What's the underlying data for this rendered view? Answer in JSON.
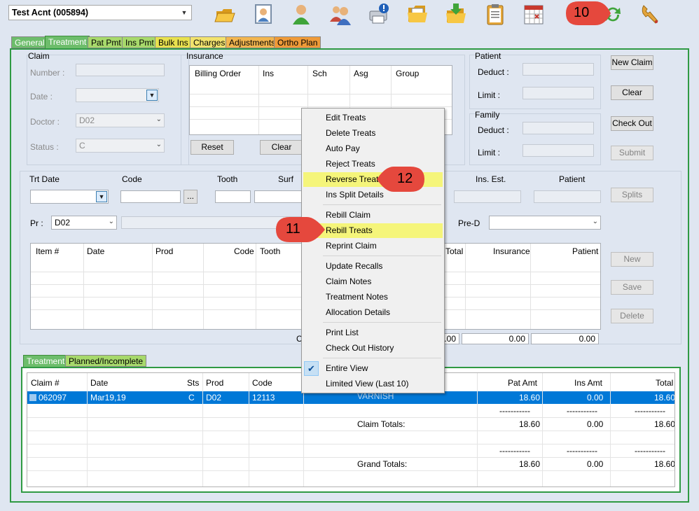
{
  "account": {
    "name": "Test Acnt (005894)"
  },
  "toolbar": {
    "icons": [
      "folder-open-icon",
      "patient-portrait-icon",
      "person-icon",
      "family-icon",
      "printer-alert-icon",
      "files-icon",
      "download-folder-icon",
      "clipboard-icon",
      "calendar-icon",
      "refresh-icon",
      "wrench-icon"
    ]
  },
  "tabs": [
    {
      "label": "General",
      "color": "#6dbd6b"
    },
    {
      "label": "Treatment",
      "color": "#6dbd6b"
    },
    {
      "label": "Pat Pmt",
      "color": "#a7d96b"
    },
    {
      "label": "Ins Pmt",
      "color": "#a7d96b"
    },
    {
      "label": "Bulk Ins",
      "color": "#e8e14e"
    },
    {
      "label": "Charges",
      "color": "#f2e36d"
    },
    {
      "label": "Adjustments",
      "color": "#f2b54f"
    },
    {
      "label": "Ortho Plan",
      "color": "#ef9a38"
    }
  ],
  "claim": {
    "title": "Claim",
    "number_label": "Number :",
    "date_label": "Date :",
    "doctor_label": "Doctor :",
    "doctor_value": "D02",
    "status_label": "Status :",
    "status_value": "C"
  },
  "insurance": {
    "title": "Insurance",
    "columns": [
      "Billing Order",
      "Ins",
      "Sch",
      "Asg",
      "Group"
    ],
    "reset_label": "Reset",
    "clear_label": "Clear"
  },
  "patient": {
    "title": "Patient",
    "deduct_label": "Deduct :",
    "limit_label": "Limit :"
  },
  "family": {
    "title": "Family",
    "deduct_label": "Deduct :",
    "limit_label": "Limit :"
  },
  "side_buttons": {
    "new_claim": "New Claim",
    "clear": "Clear",
    "check_out": "Check Out",
    "submit": "Submit",
    "splits": "Splits",
    "new": "New",
    "save": "Save",
    "delete": "Delete"
  },
  "treatment_entry": {
    "trt_date_label": "Trt Date",
    "code_label": "Code",
    "tooth_label": "Tooth",
    "surf_label": "Surf",
    "ins_est_label": "Ins. Est.",
    "patient_label": "Patient",
    "browse_label": "...",
    "pr_label": "Pr :",
    "pr_value": "D02",
    "pre_d_label": "Pre-D"
  },
  "items_grid": {
    "columns": [
      "Item #",
      "Date",
      "Prod",
      "Code",
      "Tooth",
      "Total",
      "Insurance",
      "Patient"
    ],
    "totals_label_partial": "C",
    "totals": [
      "0.00",
      "0.00",
      "0.00"
    ]
  },
  "bottom_tabs": [
    {
      "label": "Treatment",
      "color": "#6dbd6b"
    },
    {
      "label": "Planned/Incomplete",
      "color": "#a7d96b"
    }
  ],
  "history": {
    "columns": [
      "Claim #",
      "Date",
      "Sts",
      "Prod",
      "Code",
      "Pat Amt",
      "Ins Amt",
      "Total"
    ],
    "selected_row": {
      "claim": "062097",
      "date": "Mar19,19",
      "sts": "C",
      "prod": "D02",
      "code": "12113",
      "desc": "VARNISH",
      "pat_amt": "18.60",
      "ins_amt": "0.00",
      "total": "18.60"
    },
    "dashes": "-----------",
    "claim_totals": {
      "label": "Claim Totals:",
      "pat_amt": "18.60",
      "ins_amt": "0.00",
      "total": "18.60"
    },
    "grand_totals": {
      "label": "Grand Totals:",
      "pat_amt": "18.60",
      "ins_amt": "0.00",
      "total": "18.60"
    }
  },
  "context_menu": {
    "groups": [
      [
        "Edit Treats",
        "Delete Treats",
        "Auto Pay",
        "Reject Treats",
        "Reverse Treats",
        "Ins Split Details"
      ],
      [
        "Rebill Claim",
        "Rebill Treats",
        "Reprint Claim"
      ],
      [
        "Update Recalls",
        "Claim Notes",
        "Treatment Notes",
        "Allocation Details"
      ],
      [
        "Print List",
        "Check Out History"
      ],
      [
        "Entire View",
        "Limited View (Last 10)"
      ]
    ],
    "highlighted": [
      "Reverse Treats",
      "Rebill Treats"
    ],
    "checked": "Entire View"
  },
  "callouts": [
    {
      "number": "10",
      "points_to": "refresh-icon"
    },
    {
      "number": "12",
      "points_to": "Reverse Treats"
    },
    {
      "number": "11",
      "points_to": "Rebill Treats"
    }
  ],
  "colors": {
    "panel_border": "#2f9a43",
    "selection": "#0078d7",
    "highlight": "#f5f57a",
    "callout": "#e5483d"
  }
}
